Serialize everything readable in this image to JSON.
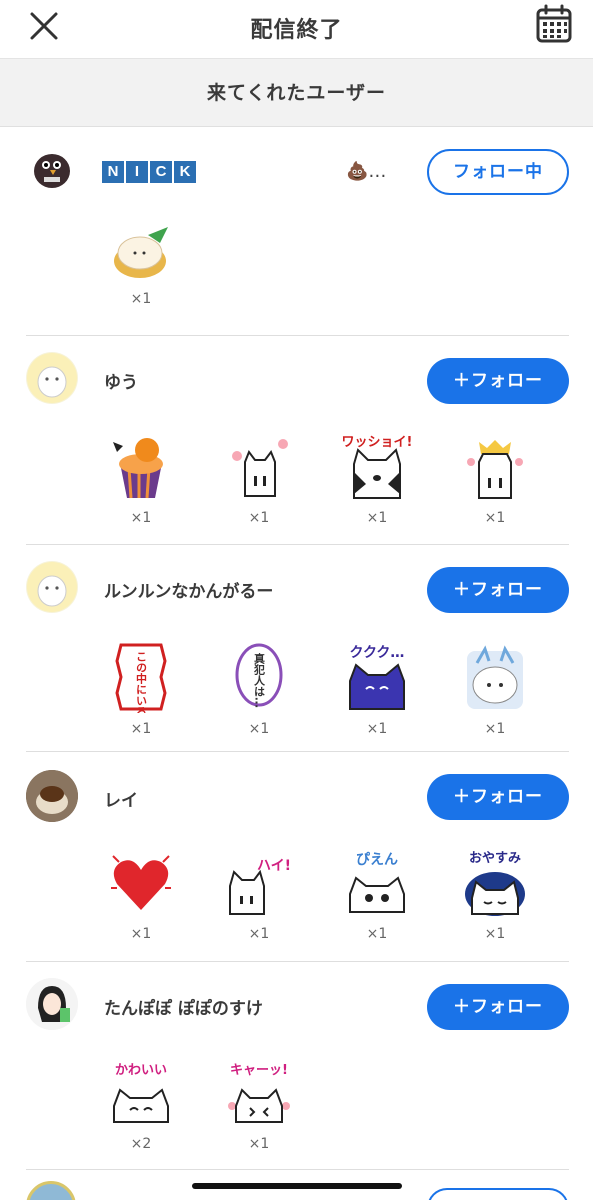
{
  "header": {
    "title": "配信終了",
    "close_icon": "close-icon",
    "calendar_icon": "calendar-icon"
  },
  "section": {
    "label": "来てくれたユーザー"
  },
  "colors": {
    "accent": "#1a73e8",
    "subheader_bg": "#f2f2f2"
  },
  "users": [
    {
      "name_letters": [
        "N",
        "I",
        "C",
        "K"
      ],
      "name_suffix": "💩…",
      "follow_label": "フォロー中",
      "gifts": [
        {
          "icon": "xiaolongbao-sticker",
          "count": "×1"
        }
      ]
    },
    {
      "name": "ゆう",
      "follow_label": "＋フォロー",
      "gifts": [
        {
          "icon": "halloween-cupcake-sticker",
          "count": "×1"
        },
        {
          "icon": "cat-flowers-sticker",
          "count": "×1"
        },
        {
          "icon": "cat-wasshoi-sticker",
          "count": "×1",
          "text": "ワッショイ!"
        },
        {
          "icon": "cat-crown-sticker",
          "count": "×1"
        }
      ]
    },
    {
      "name": "ルンルンなかんがるー",
      "follow_label": "＋フォロー",
      "gifts": [
        {
          "icon": "banner-sticker",
          "count": "×1",
          "text": "この中にいる!"
        },
        {
          "icon": "speech-bubble-sticker",
          "count": "×1",
          "text": "真犯人は…"
        },
        {
          "icon": "cat-kukuku-sticker",
          "count": "×1",
          "text": "ククク…"
        },
        {
          "icon": "dragon-cat-sticker",
          "count": "×1"
        }
      ]
    },
    {
      "name": "レイ",
      "follow_label": "＋フォロー",
      "gifts": [
        {
          "icon": "heart-sticker",
          "count": "×1"
        },
        {
          "icon": "cat-hai-sticker",
          "count": "×1",
          "text": "ハイ!"
        },
        {
          "icon": "cat-pien-sticker",
          "count": "×1",
          "text": "ぴえん"
        },
        {
          "icon": "cat-oyasumi-sticker",
          "count": "×1",
          "text": "おやすみ"
        }
      ]
    },
    {
      "name": "たんぽぽ ぽぽのすけ",
      "follow_label": "＋フォロー",
      "gifts": [
        {
          "icon": "cat-kawaii-sticker",
          "count": "×2",
          "text": "かわいい"
        },
        {
          "icon": "cat-kya-sticker",
          "count": "×1",
          "text": "キャーッ!"
        }
      ]
    }
  ]
}
